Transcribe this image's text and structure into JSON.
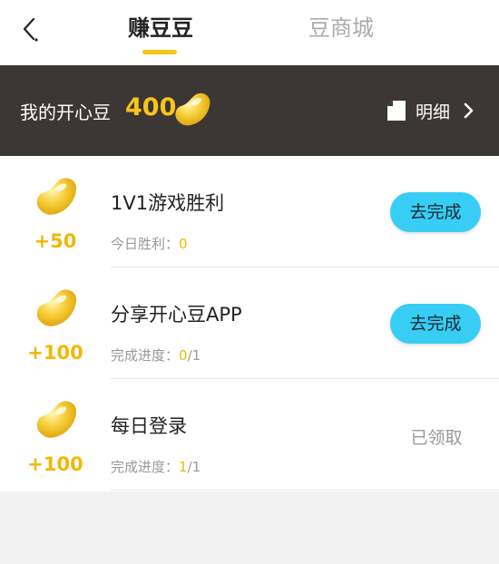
{
  "header": {
    "tabs": [
      {
        "label": "赚豆豆",
        "active": true
      },
      {
        "label": "豆商城",
        "active": false
      }
    ]
  },
  "banner": {
    "label": "我的开心豆",
    "amount": "400",
    "detail_label": "明细"
  },
  "tasks": [
    {
      "reward": "+50",
      "title": "1V1游戏胜利",
      "progress_label": "今日胜利：",
      "progress_done": "0",
      "progress_total": "",
      "action_label": "去完成",
      "completed": false
    },
    {
      "reward": "+100",
      "title": "分享开心豆APP",
      "progress_label": "完成进度：",
      "progress_done": "0",
      "progress_total": "/1",
      "action_label": "去完成",
      "completed": false
    },
    {
      "reward": "+100",
      "title": "每日登录",
      "progress_label": "完成进度：",
      "progress_done": "1",
      "progress_total": "/1",
      "status_label": "已领取",
      "completed": true
    }
  ],
  "colors": {
    "accent": "#f5c515",
    "reward": "#f2b705",
    "banner_bg": "#3c3635",
    "action_button": "#37cdf4"
  }
}
